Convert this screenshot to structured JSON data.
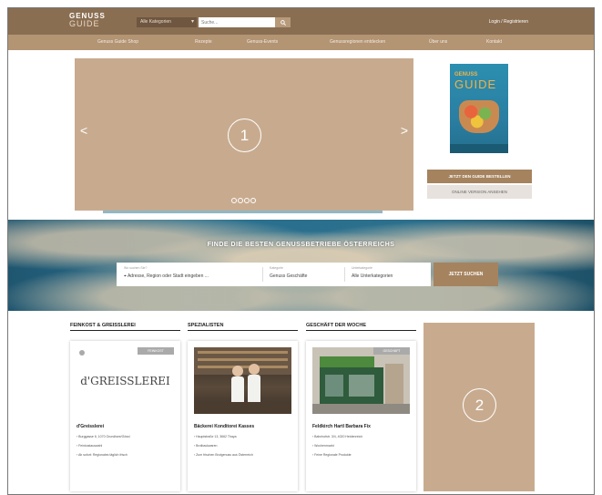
{
  "header": {
    "logo_line1": "GENUSS",
    "logo_line2": "GUIDE",
    "category_select": "Alle Kategorien",
    "search_placeholder": "Suche...",
    "login": "Login / Registrieren"
  },
  "nav": {
    "items": [
      "Genuss Guide Shop",
      "Rezepte",
      "Genuss-Events",
      "Genussregionen entdecken",
      "Über uns",
      "Kontakt"
    ]
  },
  "slider": {
    "number": "1",
    "prev_arrow": "<",
    "next_arrow": ">",
    "dots": 4
  },
  "promo": {
    "book_brand": "GENUSS",
    "book_title": "GUIDE",
    "buy_button": "JETZT DEN GUIDE BESTELLEN",
    "online_button": "ONLINE VERSION ANSEHEN"
  },
  "search_band": {
    "title": "FINDE DIE BESTEN GENUSSBETRIEBE ÖSTERREICHS",
    "field1_label": "Wo suchen Sie?",
    "field1_value": "Adresse, Region oder Stadt eingeben ...",
    "field2_label": "Kategorie",
    "field2_value": "Genuss Geschäfte",
    "field3_label": "Unterkategorie",
    "field3_value": "Alle Unterkategorien",
    "submit": "JETZT SUCHEN"
  },
  "columns": [
    {
      "title": "FEINKOST & GREISSLEREI",
      "tag": "FEINKOST",
      "image_text": "d'GREISSLEREI",
      "name": "d'Greisslerei",
      "lines": [
        "Burggasse 6, 1070 Grundlsee/Gössl",
        "Feinkostauswahl",
        "Ab sofort: Regionales täglich frisch"
      ]
    },
    {
      "title": "SPEZIALISTEN",
      "tag": "",
      "image_text": "",
      "name": "Bäckerei Konditorei Kasses",
      "lines": [
        "Hauptstraße 13, 3662 Thaya",
        "Brotbackwaren",
        "Zum frischen Brotgenuss aus Österreich"
      ]
    },
    {
      "title": "GESCHÄFT DER WOCHE",
      "tag": "GESCHÄFT",
      "image_text": "",
      "name": "Feldkirch Hartl Barbara Fix",
      "lines": [
        "Bahnhofstr. 3/4, 4020 Heidenreich",
        "Wochenmarkt",
        "Feine Regionale Produkte"
      ]
    }
  ],
  "ad2": {
    "number": "2"
  },
  "colors": {
    "brand_brown": "#8a6e52",
    "nav_brown": "#b39473",
    "placeholder_tan": "#c8ab8f",
    "accent_button": "#a5835f"
  }
}
